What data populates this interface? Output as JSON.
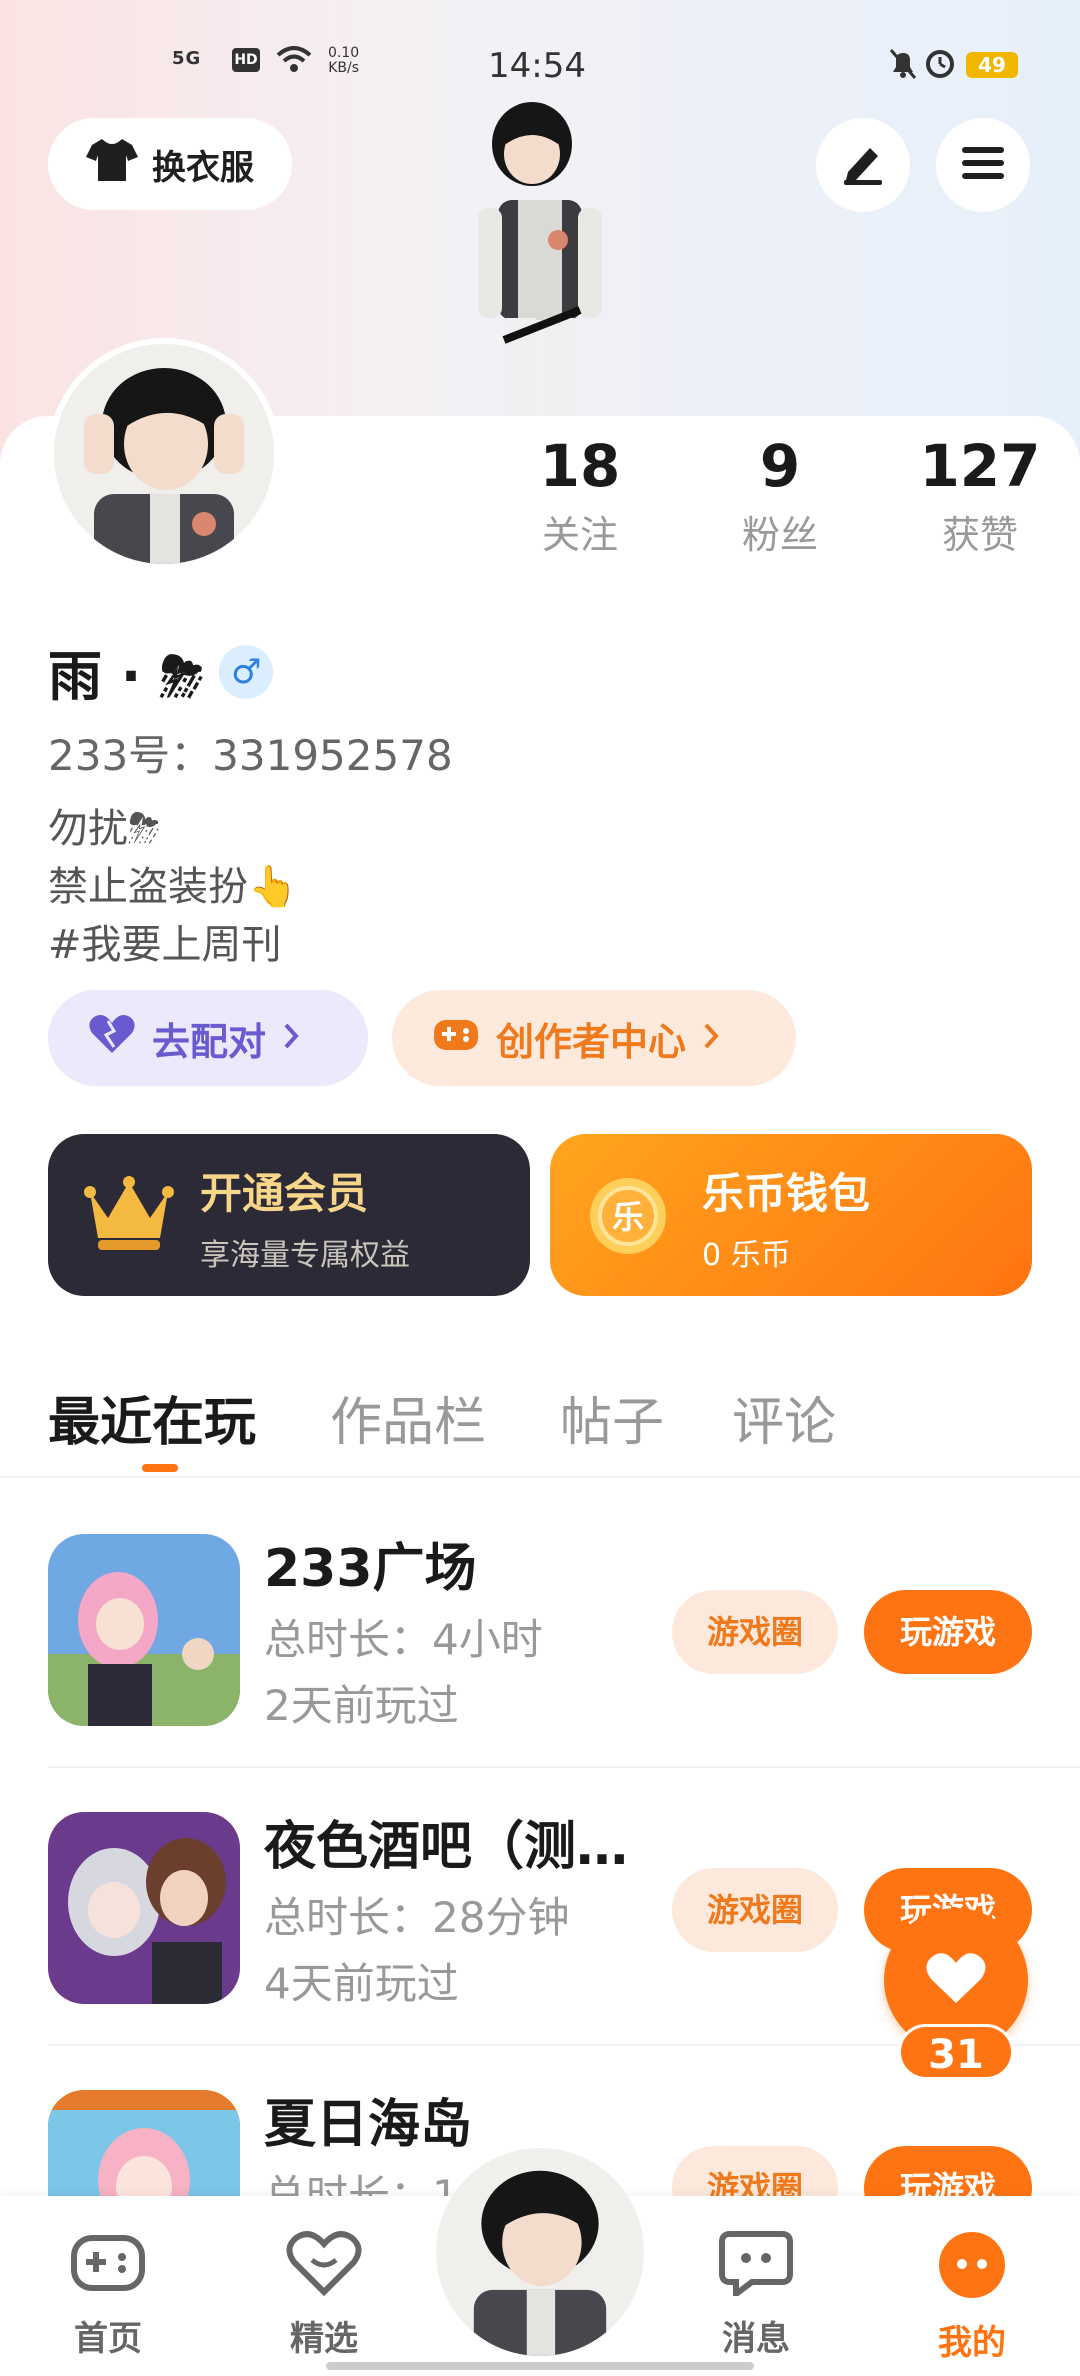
{
  "status_bar": {
    "network": "5G",
    "hd": "HD",
    "speed_value": "0.10",
    "speed_unit": "KB/s",
    "time": "14:54",
    "battery": "49"
  },
  "header": {
    "dress_button": "换衣服",
    "edit_icon": "pencil-icon",
    "menu_icon": "menu-icon"
  },
  "stats": [
    {
      "value": "18",
      "label": "关注"
    },
    {
      "value": "9",
      "label": "粉丝"
    },
    {
      "value": "127",
      "label": "获赞"
    }
  ],
  "profile": {
    "name": "雨 · ⛈",
    "gender": "♂",
    "uid": "233号：331952578",
    "bio": "勿扰⛈\n禁止盗装扮👆\n#我要上周刊"
  },
  "pills": {
    "pair": "去配对",
    "creator": "创作者中心"
  },
  "membership": {
    "title": "开通会员",
    "subtitle": "享海量专属权益"
  },
  "wallet": {
    "title": "乐币钱包",
    "subtitle": "0 乐币",
    "coin_char": "乐"
  },
  "tabs": [
    "最近在玩",
    "作品栏",
    "帖子",
    "评论"
  ],
  "games": [
    {
      "title": "233广场",
      "duration": "总时长：4小时",
      "last_played": "2天前玩过",
      "circle_label": "游戏圈",
      "play_label": "玩游戏"
    },
    {
      "title": "夜色酒吧（测…",
      "duration": "总时长：28分钟",
      "last_played": "4天前玩过",
      "circle_label": "游戏圈",
      "play_label": "玩游戏"
    },
    {
      "title": "夏日海岛",
      "duration": "总时长：1",
      "last_played": "",
      "circle_label": "游戏圈",
      "play_label": "玩游戏"
    }
  ],
  "floating_like": {
    "count": "31"
  },
  "bottom_nav": [
    {
      "label": "首页"
    },
    {
      "label": "精选"
    },
    {
      "label": "消息"
    },
    {
      "label": "我的"
    }
  ],
  "colors": {
    "accent": "#ff7412",
    "purple": "#6a5ad0",
    "dark_card": "#2b2a36"
  }
}
